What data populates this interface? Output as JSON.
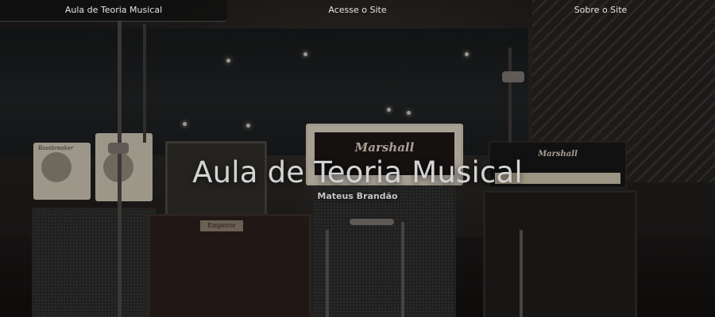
{
  "nav": {
    "items": [
      {
        "label": "Aula de Teoria Musical"
      },
      {
        "label": "Acesse o Site"
      },
      {
        "label": "Sobre o Site"
      }
    ]
  },
  "hero": {
    "title": "Aula de Teoria Musical",
    "subtitle": "Mateus Brandão",
    "background_image": "studio-amplifiers-photo",
    "amp_logos": {
      "center_head": "Marshall",
      "right_head": "Marshall",
      "left_cabinet_badge": "Emperor",
      "small_amp": "Bassbreaker"
    }
  },
  "colors": {
    "nav_active_bg": "#101010",
    "nav_text": "#e7e4e0",
    "title_text": "#d3d3d4"
  }
}
